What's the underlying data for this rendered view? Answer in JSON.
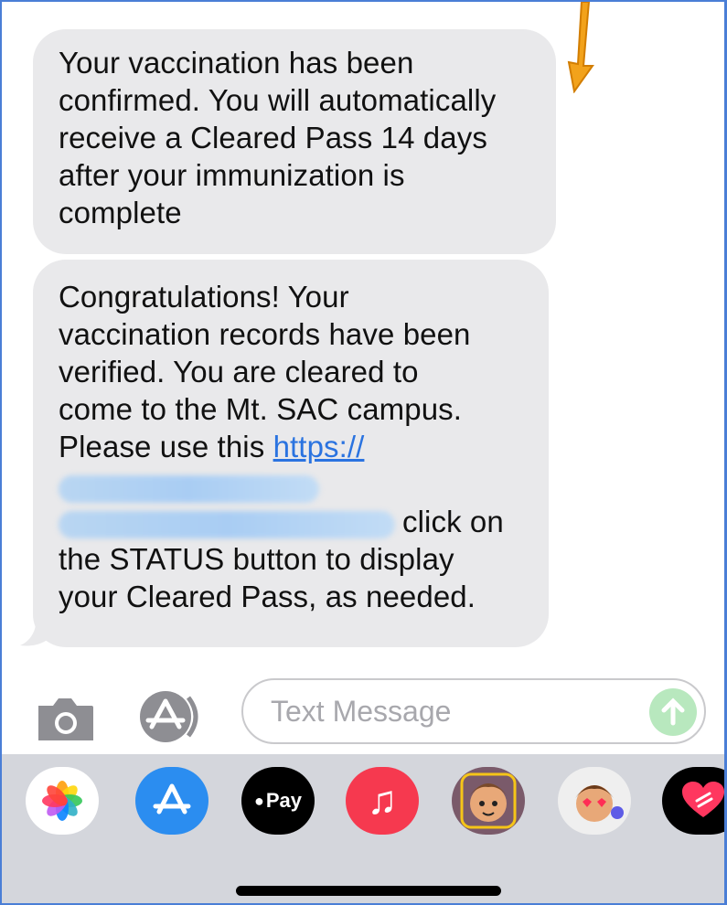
{
  "messages": [
    {
      "text": "Your vaccination has been confirmed.  You will automatically receive a Cleared Pass 14 days after your immunization is complete"
    },
    {
      "line1": "Congratulations! Your",
      "line2": "vaccination records have been",
      "line3": "verified. You are cleared to",
      "line4": "come to the Mt. SAC campus.",
      "line5_prefix": "Please use this ",
      "link": "https://",
      "after_blur": "click on",
      "line8": "the STATUS button to display",
      "line9": "your Cleared Pass, as needed."
    }
  ],
  "composer": {
    "placeholder": "Text Message"
  },
  "app_tray": {
    "apple_pay_label": "Pay",
    "icons": [
      "photos-icon",
      "app-store-icon",
      "apple-pay-icon",
      "music-icon",
      "memoji-icon",
      "memoji-sticker-icon",
      "digital-touch-icon"
    ]
  },
  "colors": {
    "bubble": "#e9e9eb",
    "link": "#2a73e0",
    "annotation_arrow": "#f2a21b",
    "send_button": "#b8e8be",
    "tray": "#d4d6dc"
  }
}
